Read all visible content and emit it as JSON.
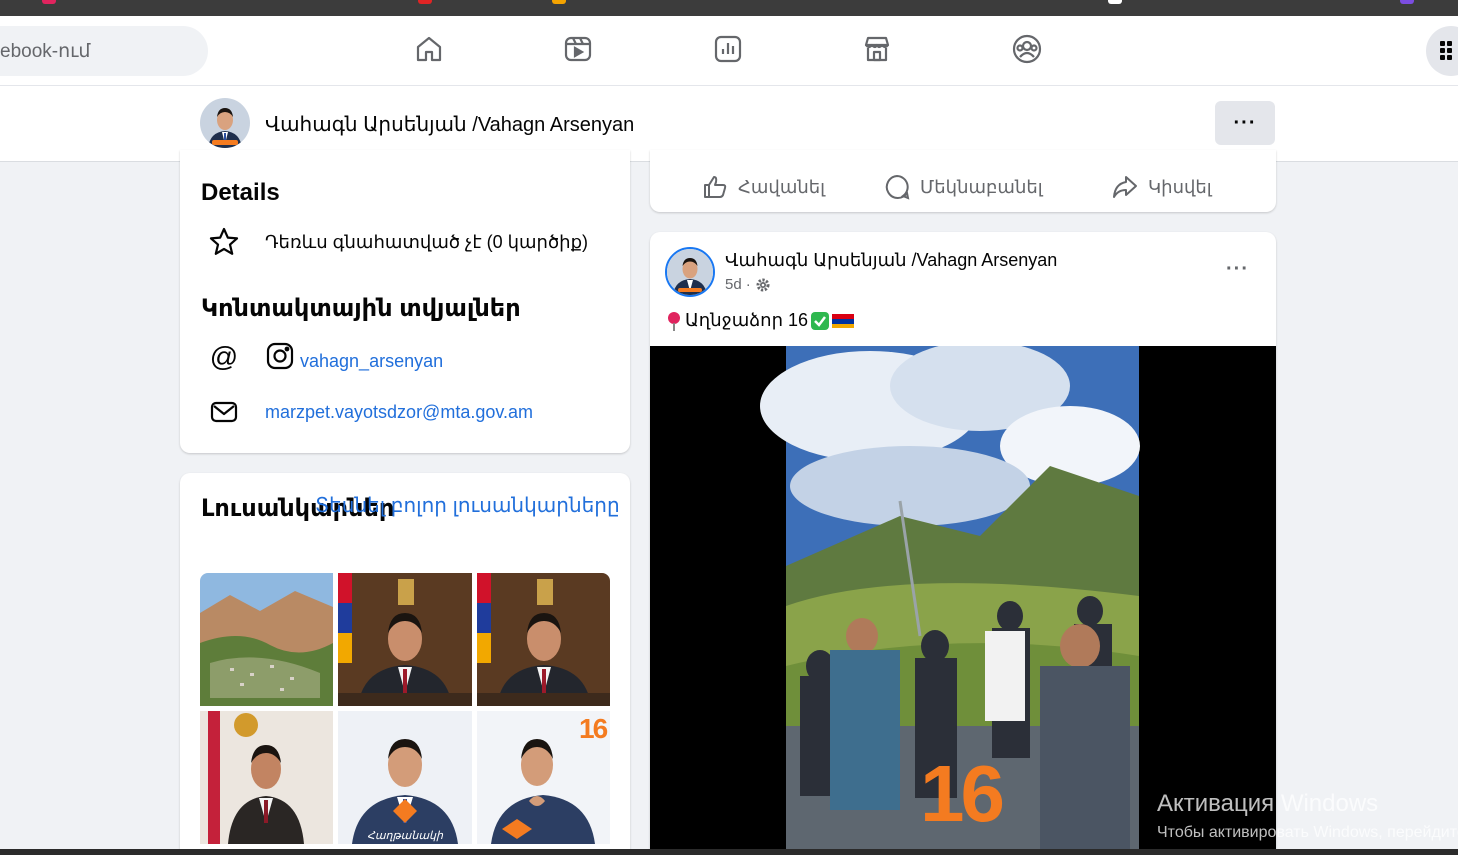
{
  "nav": {
    "search_placeholder": "ebook-ում",
    "icons": [
      "home-icon",
      "video-icon",
      "dashboard-icon",
      "marketplace-icon",
      "groups-icon",
      "menu-grid-icon"
    ]
  },
  "profile": {
    "name": "Վահագն Արսենյան /Vahagn Arsenyan",
    "more_label": "···"
  },
  "details": {
    "title": "Details",
    "rating_text": "Դեռևս գնահատված չէ (0 կարծիք)",
    "contact_title": "Կոնտակտային տվյալներ",
    "instagram": "vahagn_arsenyan",
    "email": "marzpet.vayotsdzor@mta.gov.am"
  },
  "photos": {
    "title": "Լուսանկարներ",
    "see_all": "Տեսնել բոլոր լուսանկարները",
    "overlay_16": "16"
  },
  "actions": {
    "like": "Հավանել",
    "comment": "Մեկնաբանել",
    "share": "Կիսվել"
  },
  "post": {
    "author": "Վահագն Արսենյան /Vahagn Arsenyan",
    "time": "5d",
    "separator": "·",
    "text": "Աղնջաձոր 16",
    "more_label": "···",
    "video_overlay": "16"
  },
  "watermark": {
    "line1": "Активация Windows",
    "line2": "Чтобы активировать Windows, перейдите"
  },
  "colors": {
    "accent": "#1877f2",
    "link": "#216fdb",
    "brand_orange": "#f47b20"
  }
}
